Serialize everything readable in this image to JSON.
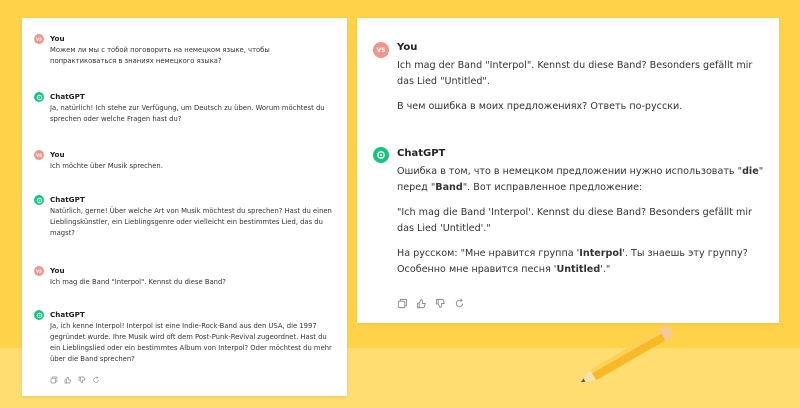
{
  "left": {
    "messages": [
      {
        "author": "You",
        "avatar": "VS",
        "text": "Можем ли мы с тобой поговорить на немецком языке, чтобы попрактиковаться в знаниях немецкого языка?"
      },
      {
        "author": "ChatGPT",
        "text": "Ja, natürlich! Ich stehe zur Verfügung, um Deutsch zu üben. Worum möchtest du sprechen oder welche Fragen hast du?"
      },
      {
        "author": "You",
        "avatar": "VS",
        "text": "Ich möchte über Musik sprechen."
      },
      {
        "author": "ChatGPT",
        "text": "Natürlich, gerne! Über welche Art von Musik möchtest du sprechen? Hast du einen Lieblingskünstler, ein Lieblingsgenre oder vielleicht ein bestimmtes Lied, das du magst?"
      },
      {
        "author": "You",
        "avatar": "VS",
        "text": "Ich mag die Band \"Interpol\". Kennst du diese Band?"
      },
      {
        "author": "ChatGPT",
        "text": "Ja, ich kenne Interpol! Interpol ist eine Indie-Rock-Band aus den USA, die 1997 gegründet wurde. Ihre Musik wird oft dem Post-Punk-Revival zugeordnet. Hast du ein Lieblingslied oder ein bestimmtes Album von Interpol? Oder möchtest du mehr über die Band sprechen?"
      }
    ]
  },
  "right": {
    "user": {
      "author": "You",
      "avatar": "VS",
      "line1": "Ich mag der Band \"Interpol\". Kennst du diese Band? Besonders gefällt mir das Lied \"Untitled\".",
      "line2": "В чем ошибка в моих предложениях? Ответь по-русски."
    },
    "bot": {
      "author": "ChatGPT",
      "p1_a": "Ошибка в том, что в немецком предложении нужно использовать \"",
      "p1_b": "die",
      "p1_c": "\" перед \"",
      "p1_d": "Band",
      "p1_e": "\". Вот исправленное предложение:",
      "p2": "\"Ich mag die Band 'Interpol'. Kennst du diese Band? Besonders gefällt mir das Lied 'Untitled'.\"",
      "p3_a": "На русском: \"Мне нравится группа '",
      "p3_b": "Interpol",
      "p3_c": "'. Ты знаешь эту группу? Особенно мне нравится песня '",
      "p3_d": "Untitled",
      "p3_e": "'.\""
    }
  },
  "icons": [
    "copy-icon",
    "thumbs-up-icon",
    "thumbs-down-icon",
    "regenerate-icon"
  ],
  "colors": {
    "background": "#ffd24a",
    "user_avatar": "#f0958a",
    "bot_avatar": "#19c37d",
    "pencil": "#f7b928"
  }
}
